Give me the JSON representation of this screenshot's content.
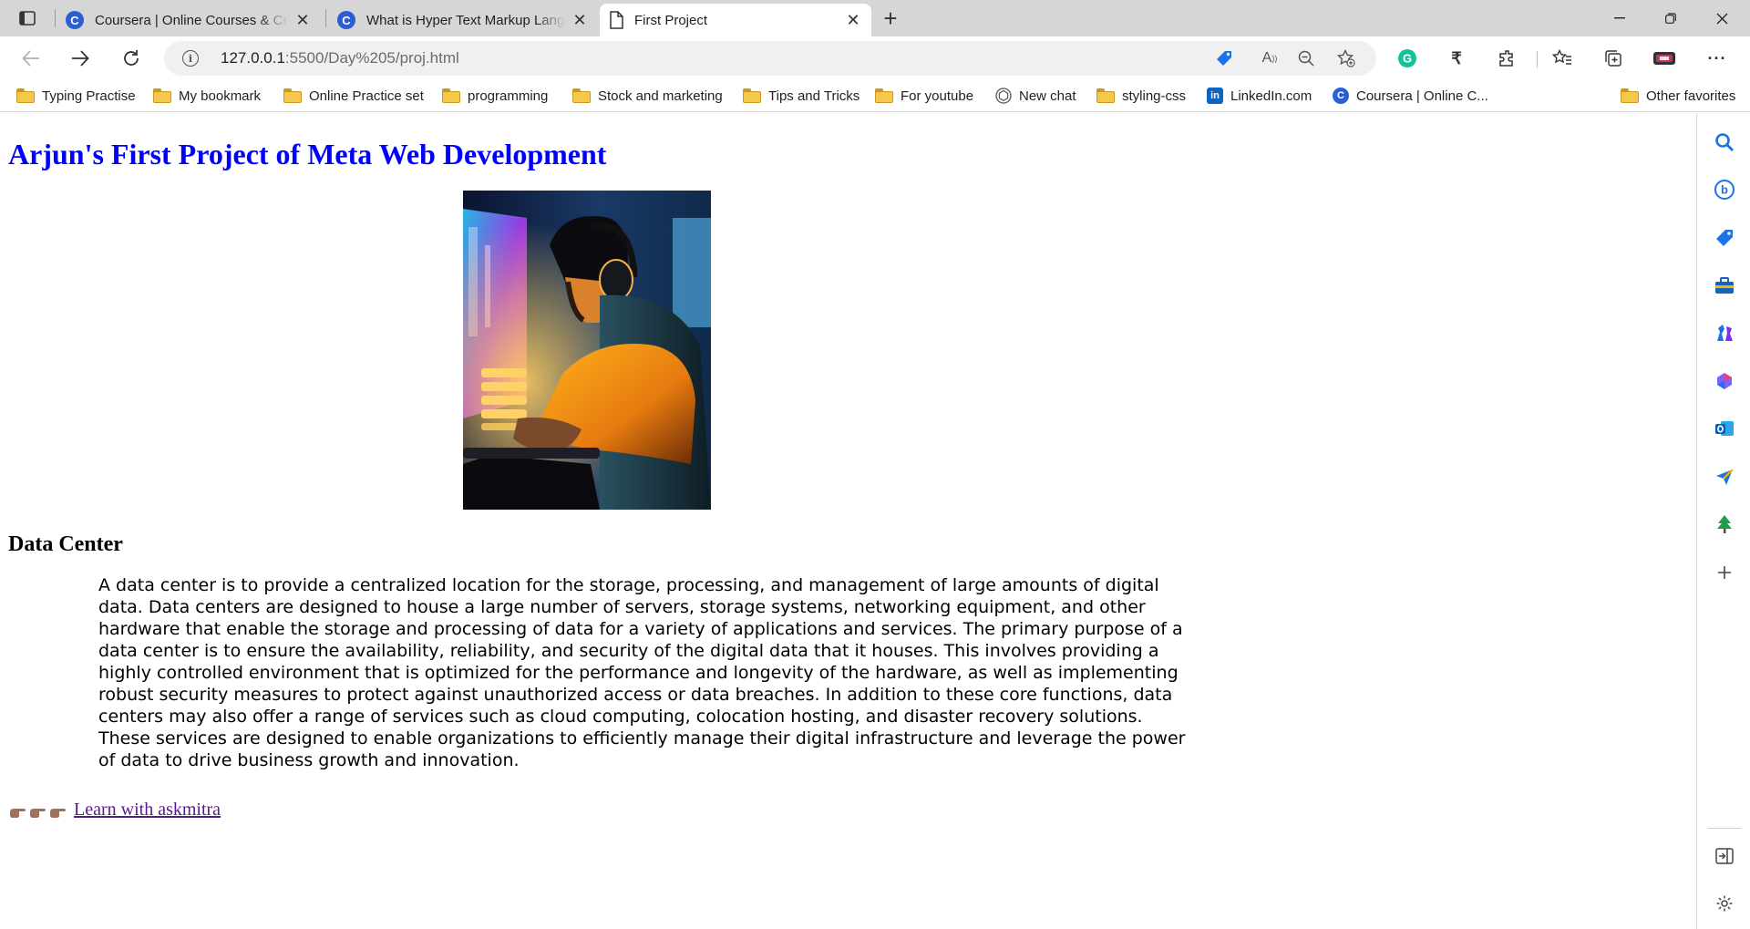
{
  "browser": {
    "tabs": [
      {
        "title": "Coursera | Online Courses & Credentials From Top Educators",
        "favicon": "C",
        "active": false
      },
      {
        "title": "What is Hyper Text Markup Language (HTML)?",
        "favicon": "C",
        "active": false
      },
      {
        "title": "First Project",
        "favicon": "page",
        "active": true
      }
    ],
    "new_tab_glyph": "+",
    "url": {
      "host": "127.0.0.1",
      "path": ":5500/Day%205/proj.html"
    },
    "bookmarks": [
      {
        "label": "Typing Practise",
        "icon": "folder-icon"
      },
      {
        "label": "My bookmark",
        "icon": "folder-icon"
      },
      {
        "label": "Online Practice set",
        "icon": "folder-icon"
      },
      {
        "label": "programming",
        "icon": "folder-icon"
      },
      {
        "label": "Stock and marketing",
        "icon": "folder-icon"
      },
      {
        "label": "Tips and Tricks",
        "icon": "folder-icon"
      },
      {
        "label": "For youtube",
        "icon": "folder-icon"
      },
      {
        "label": "New chat",
        "icon": "chatgpt-icon"
      },
      {
        "label": "styling-css",
        "icon": "folder-icon"
      },
      {
        "label": "LinkedIn.com",
        "icon": "linkedin-icon"
      },
      {
        "label": "Coursera | Online C...",
        "icon": "coursera-icon"
      }
    ],
    "other_favorites": "Other favorites",
    "accent_color": "#2a5ed6"
  },
  "page": {
    "title": "Arjun's First Project of Meta Web Development",
    "title_color": "#0000ff",
    "section_heading": "Data Center",
    "description": "A data center is to provide a centralized location for the storage, processing, and management of large amounts of digital data. Data centers are designed to house a large number of servers, storage systems, networking equipment, and other hardware that enable the storage and processing of data for a variety of applications and services. The primary purpose of a data center is to ensure the availability, reliability, and security of the digital data that it houses. This involves providing a highly controlled environment that is optimized for the performance and longevity of the hardware, as well as implementing robust security measures to protect against unauthorized access or data breaches. In addition to these core functions, data centers may also offer a range of services such as cloud computing, colocation hosting, and disaster recovery solutions. These services are designed to enable organizations to efficiently manage their digital infrastructure and leverage the power of data to drive business growth and innovation.",
    "link_text": "Learn with askmitra",
    "link_color": "#551a8b"
  }
}
